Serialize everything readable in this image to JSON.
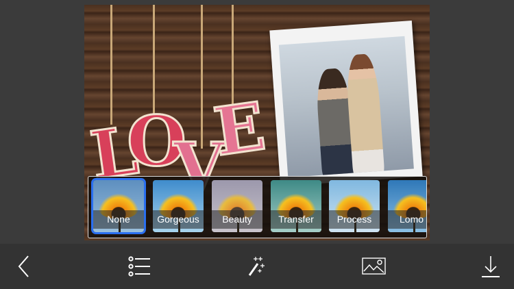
{
  "filters": [
    {
      "label": "None",
      "selected": true,
      "sky": "#6a9cc8"
    },
    {
      "label": "Gorgeous",
      "selected": false,
      "sky": "#5aa2d8"
    },
    {
      "label": "Beauty",
      "selected": false,
      "sky": "#a6a2b4"
    },
    {
      "label": "Transfer",
      "selected": false,
      "sky": "#5e9e98"
    },
    {
      "label": "Process",
      "selected": false,
      "sky": "#8cbde0"
    },
    {
      "label": "Lomo",
      "selected": false,
      "sky": "#4a8cc4"
    }
  ],
  "photo": {
    "letters": [
      "L",
      "O",
      "V",
      "E"
    ]
  },
  "toolbar": {
    "icons": [
      "back-chevron-icon",
      "list-icon",
      "magic-wand-icon",
      "image-icon",
      "download-icon"
    ]
  }
}
